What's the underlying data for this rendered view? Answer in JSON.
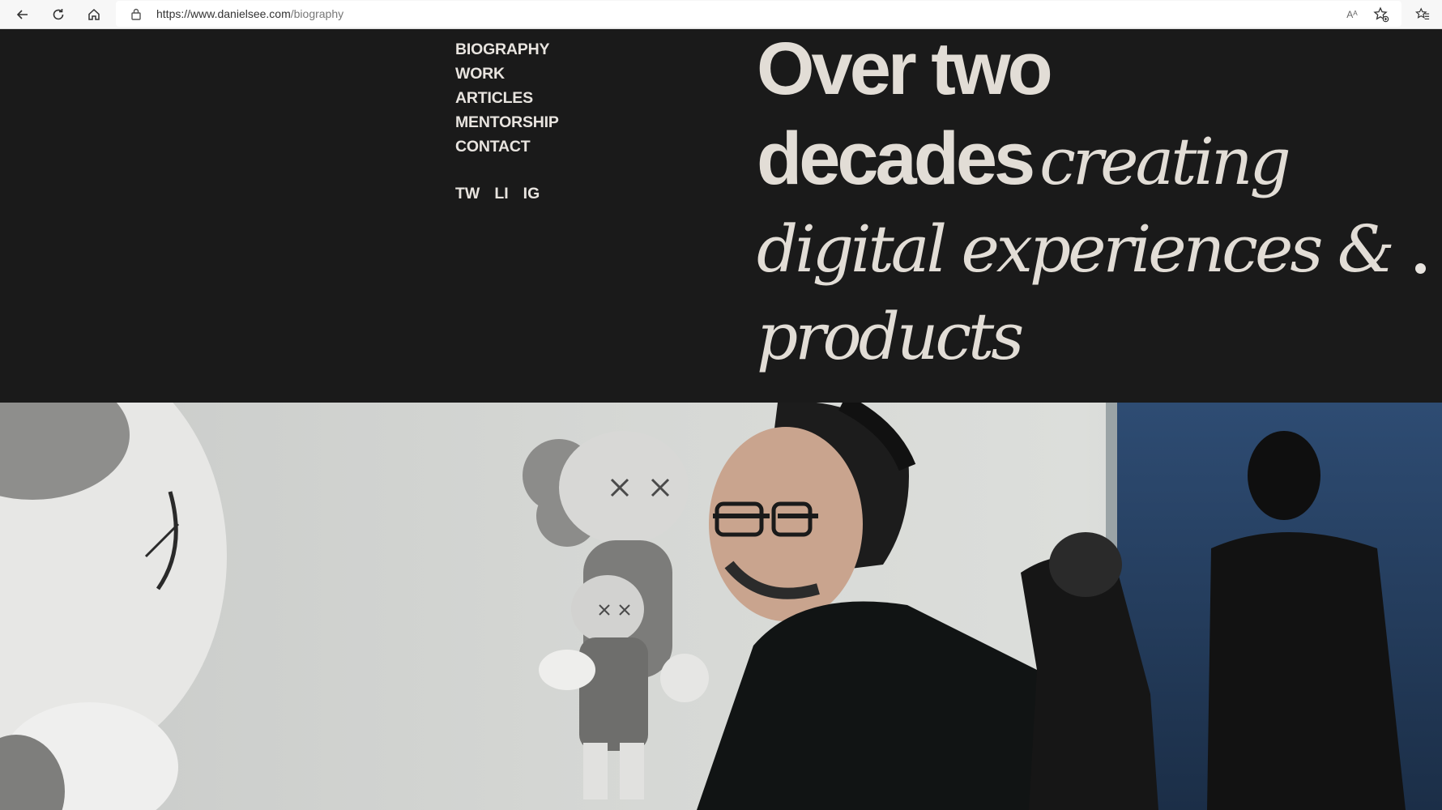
{
  "browser": {
    "url_host": "https://www.danielsee.com",
    "url_path": "/biography",
    "read_aloud": "Aᴬ"
  },
  "nav": {
    "items": [
      {
        "label": "BIOGRAPHY"
      },
      {
        "label": "WORK"
      },
      {
        "label": "ARTICLES"
      },
      {
        "label": "MENTORSHIP"
      },
      {
        "label": "CONTACT"
      }
    ],
    "socials": [
      {
        "label": "TW"
      },
      {
        "label": "LI"
      },
      {
        "label": "IG"
      }
    ]
  },
  "hero": {
    "line1": "Over two",
    "line2_bold": "decades",
    "line2_italic": "creating",
    "line3": "digital experiences &",
    "line4": "products"
  },
  "colors": {
    "hero_bg": "#1a1a1a",
    "hero_text": "#e2ddd6"
  },
  "icons": [
    "back-icon",
    "refresh-icon",
    "home-icon",
    "lock-icon",
    "read-aloud-icon",
    "add-favorite-icon",
    "favorites-icon"
  ]
}
